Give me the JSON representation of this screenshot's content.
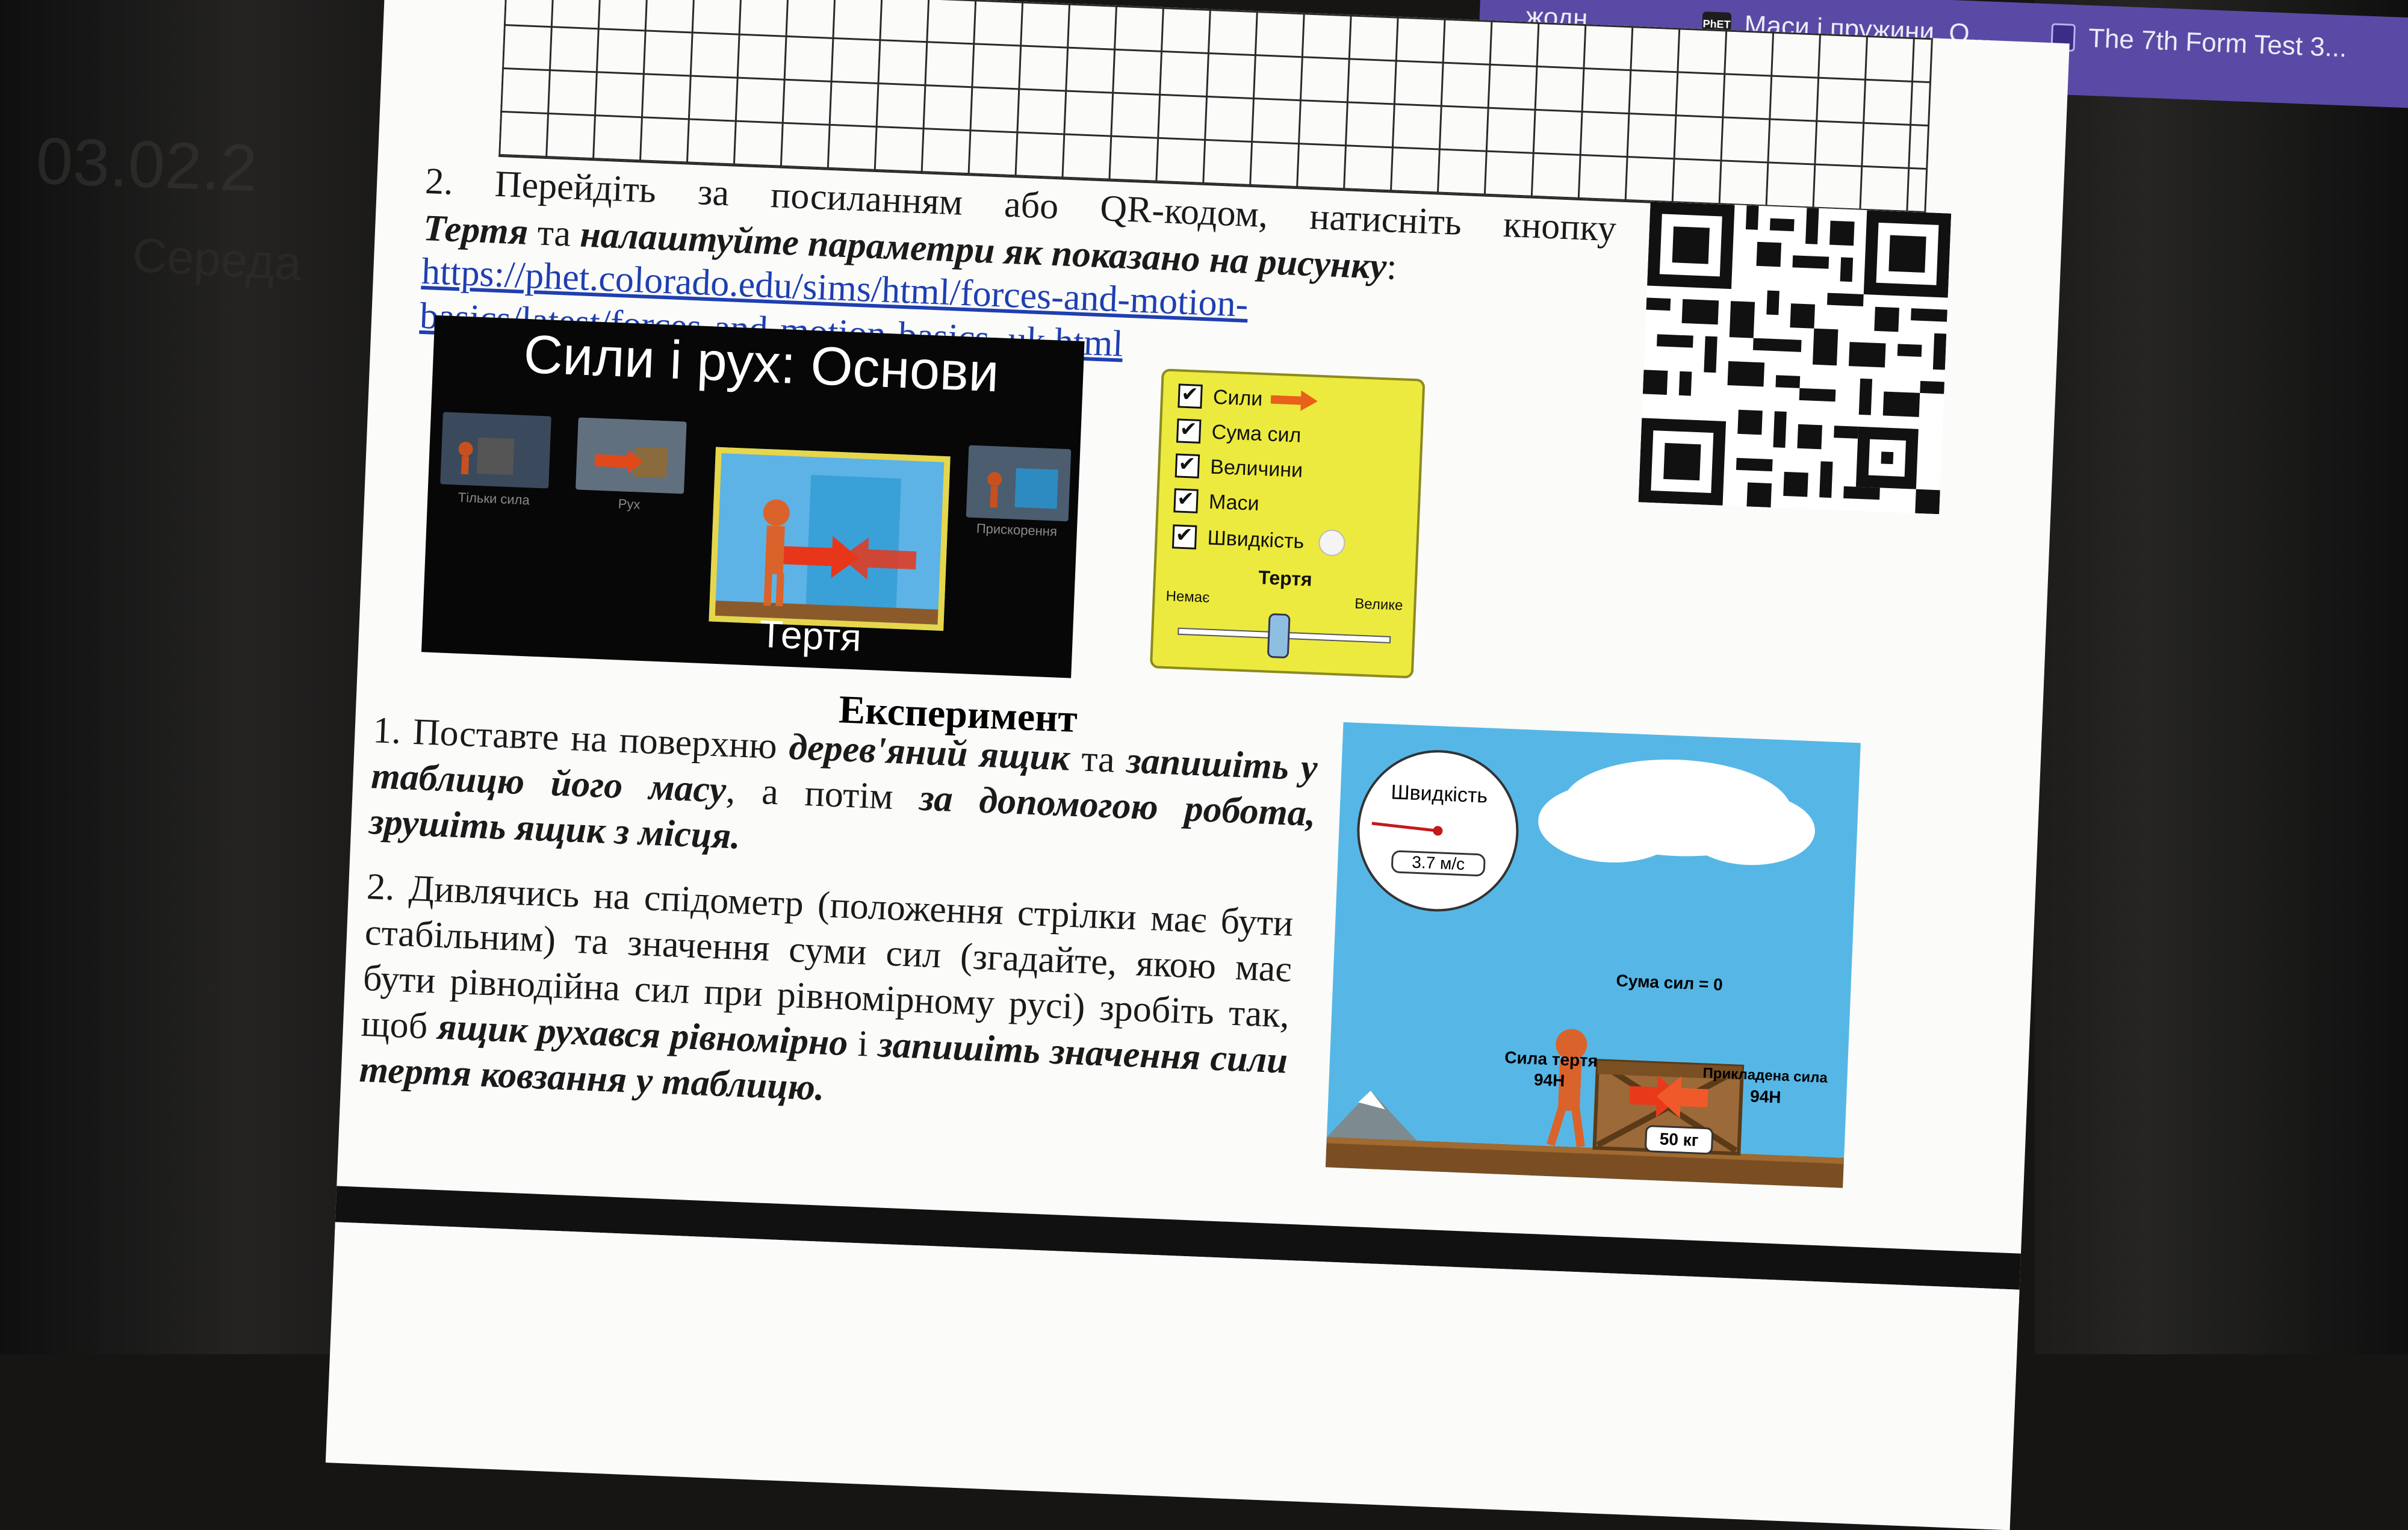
{
  "background": {
    "ghost_title": "03.02.2",
    "ghost_subtitle": "Середа"
  },
  "tabs": [
    {
      "label": "...жодн...",
      "icon": ""
    },
    {
      "label": "Маси і пружини. О...",
      "icon": "phet-icon",
      "icon_text": "PhET"
    },
    {
      "label": "The 7th Form Test 3...",
      "icon": "document-icon"
    }
  ],
  "document": {
    "task2": {
      "number": "2.",
      "line1": "Перейдіть за посиланням або QR-кодом, натисніть кнопку",
      "line2_bold1": "Тертя",
      "line2_mid": " та ",
      "line2_bold2": "налаштуйте параметри як показано на рисунку",
      "line2_end": ":",
      "link_line1": "https://phet.colorado.edu/sims/html/forces-and-motion-",
      "link_line2": "basics/latest/forces-and-motion-basics_uk.html"
    },
    "banner": {
      "title": "Сили і рух: Основи",
      "thumbs": [
        "Тільки сила",
        "Рух",
        "Прискорення"
      ],
      "selected": "Тертя"
    },
    "panel": {
      "checks": [
        "Сили",
        "Сума сил",
        "Величини",
        "Маси",
        "Швидкість"
      ],
      "friction_title": "Тертя",
      "friction_min": "Немає",
      "friction_max": "Велике"
    },
    "experiment_heading": "Експеримент",
    "step1": {
      "num": "1.",
      "a": "Поставте на поверхню ",
      "b": "дерев'яний ящик",
      "c": " та ",
      "d": "запишіть у таблицю його масу",
      "e": ", а потім ",
      "f": "за допомогою робота, зрушіть ящик з місця."
    },
    "step2": {
      "num": "2.",
      "a": "Дивлячись на спідометр (положення стрілки має бути стабільним) та значення суми сил (згадайте, якою має бути рівнодійна сил при рівномірному русі) зробіть так, щоб ",
      "b": "ящик рухався рівномірно",
      "c": " і ",
      "d": "запишіть значення сили тертя ковзання у таблицю."
    },
    "scene": {
      "speed_title": "Швидкість",
      "speed_value": "3.7 м/с",
      "sum_label": "Сума сил = 0",
      "friction_label": "Сила тертя",
      "friction_value": "94Н",
      "applied_label": "Прикладена сила",
      "applied_value": "94Н",
      "mass": "50 кг"
    }
  }
}
